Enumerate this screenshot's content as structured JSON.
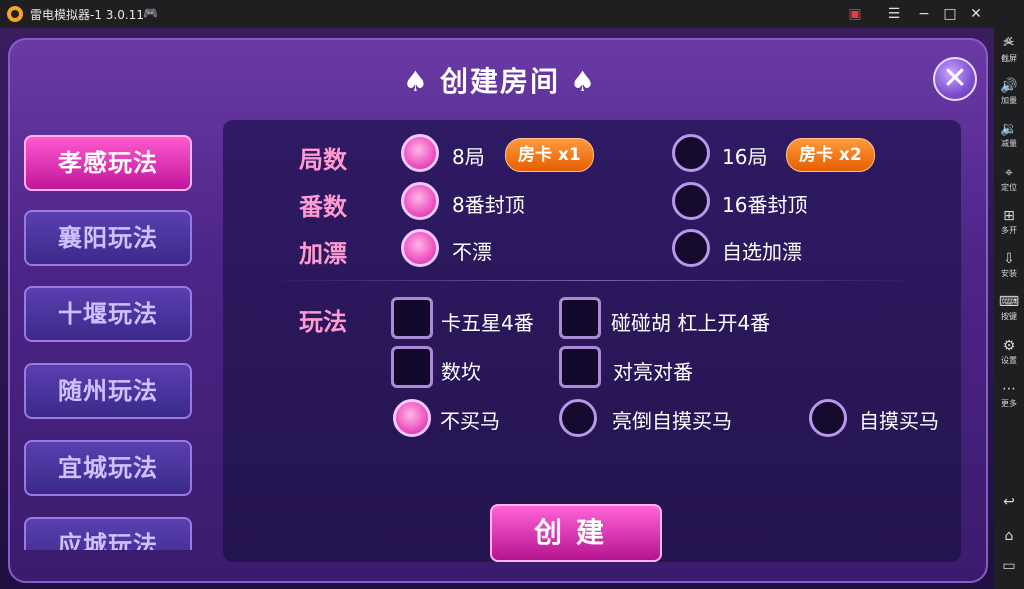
{
  "window": {
    "title": "雷电模拟器-1 3.0.11",
    "buttons": [
      "gift",
      "menu",
      "minimize",
      "maximize",
      "close"
    ]
  },
  "sidebar": {
    "items": [
      {
        "icon": "collapse-icon",
        "label": ""
      },
      {
        "icon": "scissors-icon",
        "label": "截屏"
      },
      {
        "icon": "volume-up-icon",
        "label": "加量"
      },
      {
        "icon": "volume-down-icon",
        "label": "减量"
      },
      {
        "icon": "location-icon",
        "label": "定位"
      },
      {
        "icon": "multi-open-icon",
        "label": "多开"
      },
      {
        "icon": "apk-install-icon",
        "label": "安装"
      },
      {
        "icon": "keyboard-icon",
        "label": "按键"
      },
      {
        "icon": "settings-icon",
        "label": "设置"
      },
      {
        "icon": "more-icon",
        "label": "更多"
      },
      {
        "icon": "back-icon",
        "label": ""
      },
      {
        "icon": "home-icon",
        "label": ""
      }
    ]
  },
  "dialog": {
    "title": "创建房间",
    "tabs": [
      "孝感玩法",
      "襄阳玩法",
      "十堰玩法",
      "随州玩法",
      "宜城玩法",
      "应城玩法"
    ],
    "active_tab": 0,
    "rows": {
      "rounds": {
        "label": "局数",
        "opt1": "8局",
        "badge1": "房卡 x1",
        "opt2": "16局",
        "badge2": "房卡 x2",
        "selected": 0
      },
      "fan": {
        "label": "番数",
        "opt1": "8番封顶",
        "opt2": "16番封顶",
        "selected": 0
      },
      "piao": {
        "label": "加漂",
        "opt1": "不漂",
        "opt2": "自选加漂",
        "selected": 0
      }
    },
    "play": {
      "label": "玩法",
      "check1": "卡五星4番",
      "check2": "碰碰胡 杠上开4番",
      "check3": "数坎",
      "check4": "对亮对番",
      "radio1": "不买马",
      "radio2": "亮倒自摸买马",
      "radio3": "自摸买马",
      "selected_radio": 0
    },
    "create_label": "创建"
  }
}
